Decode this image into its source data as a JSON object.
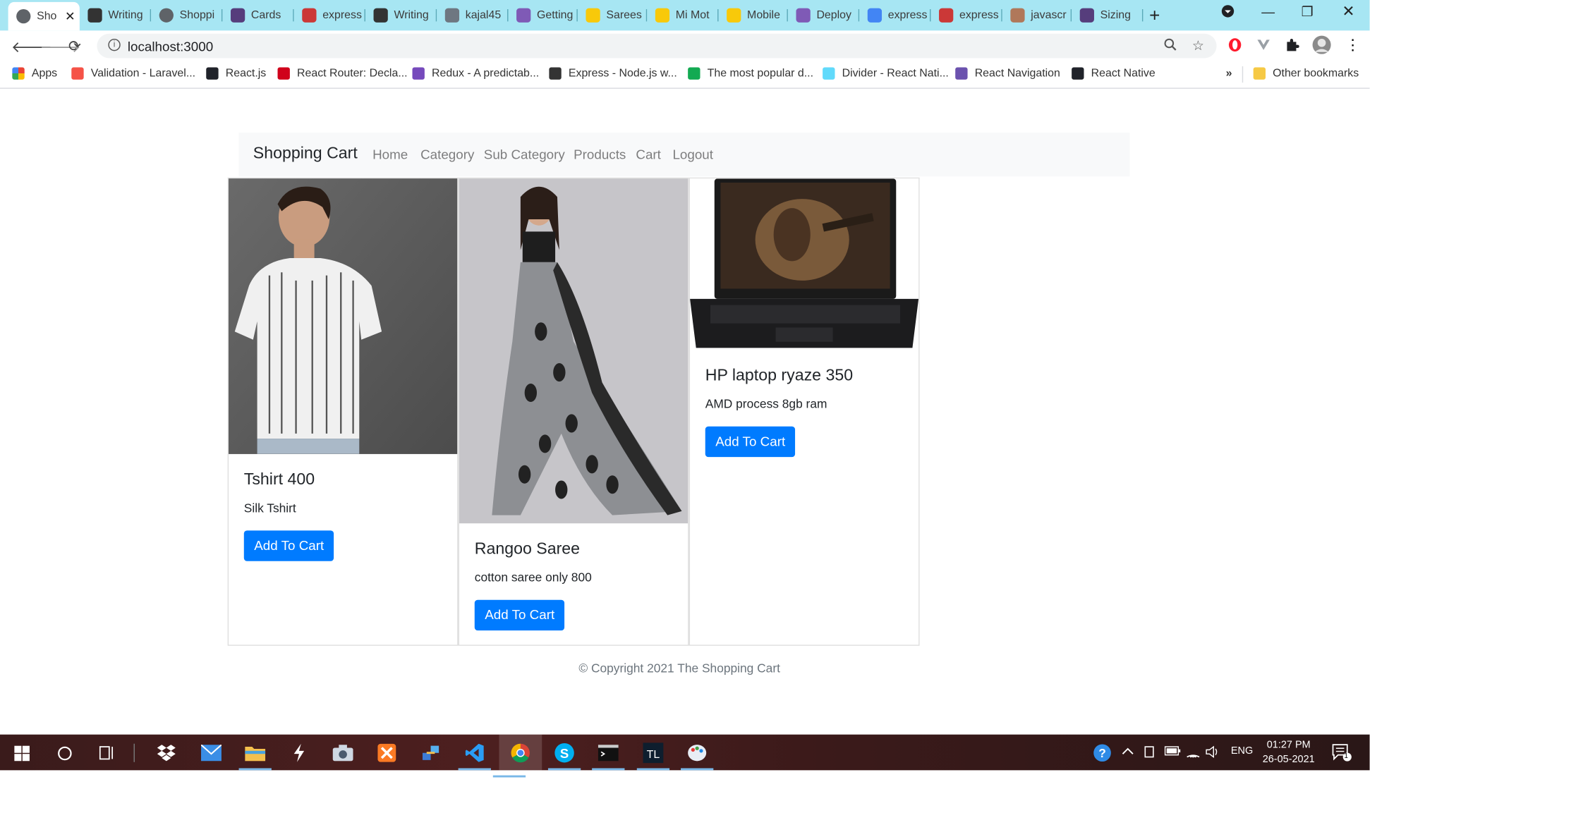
{
  "browser": {
    "tabs": [
      {
        "label": "Sho",
        "icon": "globe-icon",
        "color": "#5f6368",
        "active": true
      },
      {
        "label": "Writing",
        "icon": "ex-icon",
        "color": "#333333"
      },
      {
        "label": "Shoppi",
        "icon": "globe-icon",
        "color": "#5f6368"
      },
      {
        "label": "Cards",
        "icon": "bootstrap-icon",
        "color": "#563d7c"
      },
      {
        "label": "express",
        "icon": "npm-icon",
        "color": "#cb3837"
      },
      {
        "label": "Writing",
        "icon": "ex-icon",
        "color": "#333333"
      },
      {
        "label": "kajal45",
        "icon": "github-icon",
        "color": "#6e7781"
      },
      {
        "label": "Getting",
        "icon": "heroku-icon",
        "color": "#7f5ab6"
      },
      {
        "label": "Sarees",
        "icon": "flipkart-icon",
        "color": "#f8c90a"
      },
      {
        "label": "Mi Mot",
        "icon": "flipkart-icon",
        "color": "#f8c90a"
      },
      {
        "label": "Mobile",
        "icon": "flipkart-icon",
        "color": "#f8c90a"
      },
      {
        "label": "Deploy",
        "icon": "heroku-icon",
        "color": "#7f5ab6"
      },
      {
        "label": "express",
        "icon": "google-icon",
        "color": "#4285f4"
      },
      {
        "label": "express",
        "icon": "npm-icon",
        "color": "#cb3837"
      },
      {
        "label": "javascr",
        "icon": "pencil-icon",
        "color": "#b0785a"
      },
      {
        "label": "Sizing",
        "icon": "bootstrap-icon",
        "color": "#563d7c"
      }
    ],
    "url": "localhost:3000",
    "bookmarks": [
      {
        "label": "Apps",
        "color": "#e94235"
      },
      {
        "label": "Validation - Laravel...",
        "color": "#f55247"
      },
      {
        "label": "React.js",
        "color": "#20232a"
      },
      {
        "label": "React Router: Decla...",
        "color": "#d0021b"
      },
      {
        "label": "Redux - A predictab...",
        "color": "#764abc"
      },
      {
        "label": "Express - Node.js w...",
        "color": "#333333"
      },
      {
        "label": "The most popular d...",
        "color": "#13aa52"
      },
      {
        "label": "Divider - React Nati...",
        "color": "#61dafb"
      },
      {
        "label": "React Navigation",
        "color": "#6b52ae"
      },
      {
        "label": "React Native",
        "color": "#20232a"
      }
    ],
    "bookmarks_more": "»",
    "other_bookmarks": "Other bookmarks"
  },
  "site": {
    "brand": "Shopping Cart",
    "nav": [
      "Home",
      "Category",
      "Sub Category",
      "Products",
      "Cart",
      "Logout"
    ],
    "products": [
      {
        "title": "Tshirt 400",
        "description": "Silk Tshirt",
        "button": "Add To Cart"
      },
      {
        "title": "Rangoo Saree",
        "description": "cotton saree only 800",
        "button": "Add To Cart"
      },
      {
        "title": "HP laptop ryaze 350",
        "description": "AMD process 8gb ram",
        "button": "Add To Cart"
      }
    ],
    "footer": "© Copyright 2021 The Shopping Cart"
  },
  "taskbar": {
    "language": "ENG",
    "time": "01:27 PM",
    "date": "26-05-2021",
    "notifications": "1"
  }
}
